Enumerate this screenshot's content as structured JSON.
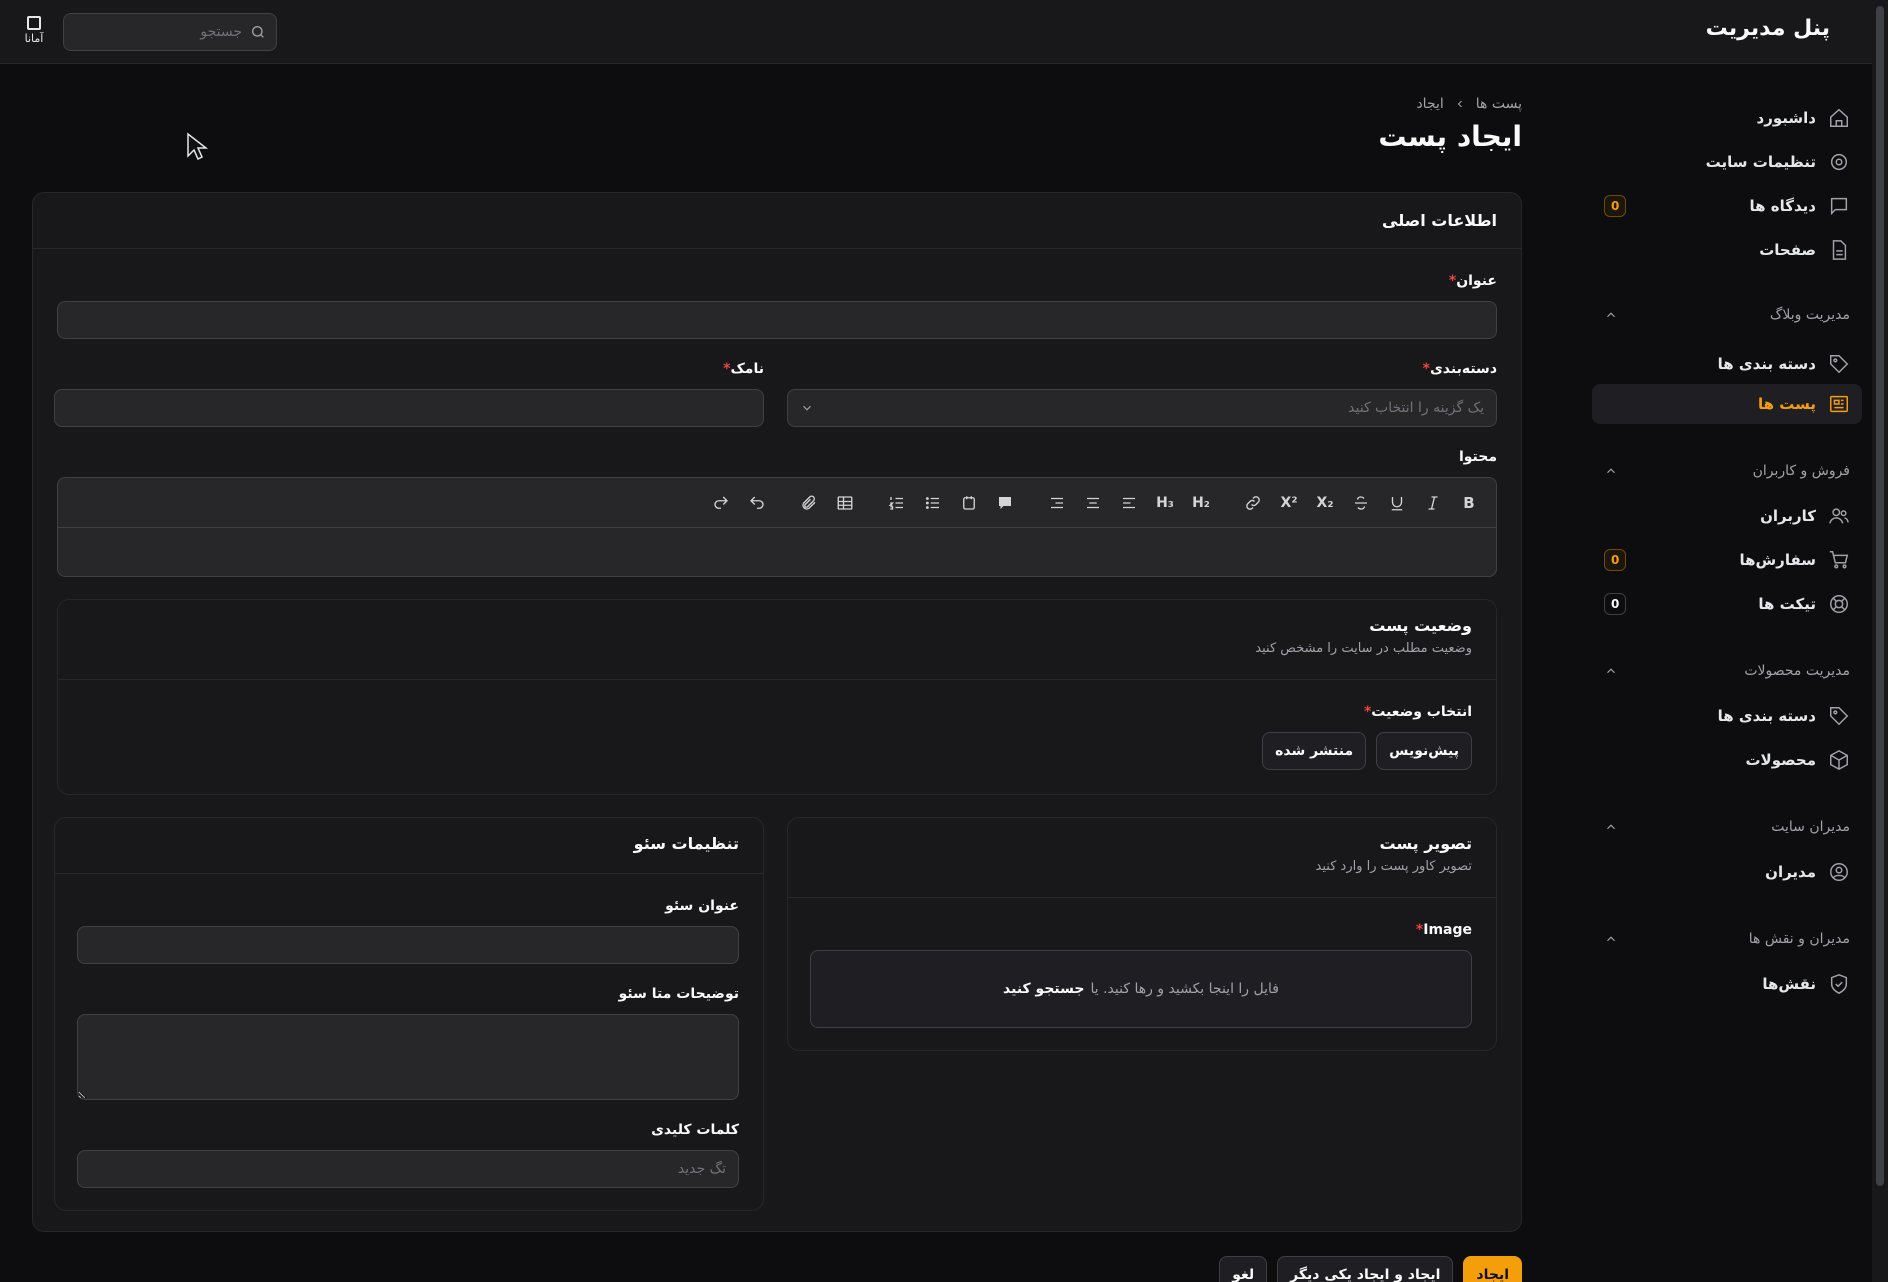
{
  "header": {
    "brand": "پنل مدیریت",
    "search_placeholder": "جستجو",
    "logo_text": "آمانا"
  },
  "sidebar": {
    "items_top": [
      {
        "label": "داشبورد",
        "icon": "home-icon"
      },
      {
        "label": "تنظیمات سایت",
        "icon": "gear-icon"
      },
      {
        "label": "دیدگاه ها",
        "icon": "comment-icon",
        "badge": "0"
      },
      {
        "label": "صفحات",
        "icon": "file-icon"
      }
    ],
    "groups": [
      {
        "title": "مدیریت وبلاگ",
        "items": [
          {
            "label": "دسته بندی ها",
            "icon": "tag-icon"
          },
          {
            "label": "پست ها",
            "icon": "newspaper-icon",
            "active": true
          }
        ]
      },
      {
        "title": "فروش و کاربران",
        "items": [
          {
            "label": "کاربران",
            "icon": "users-icon"
          },
          {
            "label": "سفارش‌ها",
            "icon": "cart-icon",
            "badge": "0"
          },
          {
            "label": "تیکت ها",
            "icon": "lifebuoy-icon",
            "badge": "0"
          }
        ]
      },
      {
        "title": "مدیریت محصولات",
        "items": [
          {
            "label": "دسته بندی ها",
            "icon": "tag-icon"
          },
          {
            "label": "محصولات",
            "icon": "cube-icon"
          }
        ]
      },
      {
        "title": "مدیران سایت",
        "items": [
          {
            "label": "مدیران",
            "icon": "user-circle-icon"
          }
        ]
      },
      {
        "title": "مدیران و نقش ها",
        "items": [
          {
            "label": "نقش‌ها",
            "icon": "shield-icon"
          }
        ]
      }
    ]
  },
  "page": {
    "breadcrumb": [
      "پست ها",
      "ایجاد"
    ],
    "title": "ایجاد پست"
  },
  "form": {
    "section_title": "اطلاعات اصلی",
    "title_label": "عنوان",
    "category_label": "دسته‌بندی",
    "category_placeholder": "یک گزینه را انتخاب کنید",
    "slug_label": "نامک",
    "content_label": "محتوا",
    "status": {
      "title": "وضعیت پست",
      "desc": "وضعیت مطلب در سایت را مشخص کنید",
      "field_label": "انتخاب وضعیت",
      "options": [
        "پیش‌نویس",
        "منتشر شده"
      ]
    },
    "image": {
      "title": "تصویر پست",
      "desc": "تصویر کاور پست را وارد کنید",
      "field_label": "Image",
      "drop_text": "فایل را اینجا بکشید و رها کنید. یا",
      "browse_text": "جستجو کنید"
    },
    "seo": {
      "title": "تنظیمات سئو",
      "seo_title_label": "عنوان سئو",
      "meta_desc_label": "توضیحات متا سئو",
      "keywords_label": "کلمات کلیدی",
      "keywords_placeholder": "تگ جدید"
    }
  },
  "toolbar": {
    "h2": "H₂",
    "h3": "H₃"
  },
  "actions": {
    "create": "ایجاد",
    "create_another": "ایجاد و ایجاد یکی دیگر",
    "cancel": "لغو"
  },
  "colors": {
    "accent": "#f59e0b",
    "background": "#0d0d0f",
    "surface": "#18181b",
    "required": "#ef4444"
  }
}
